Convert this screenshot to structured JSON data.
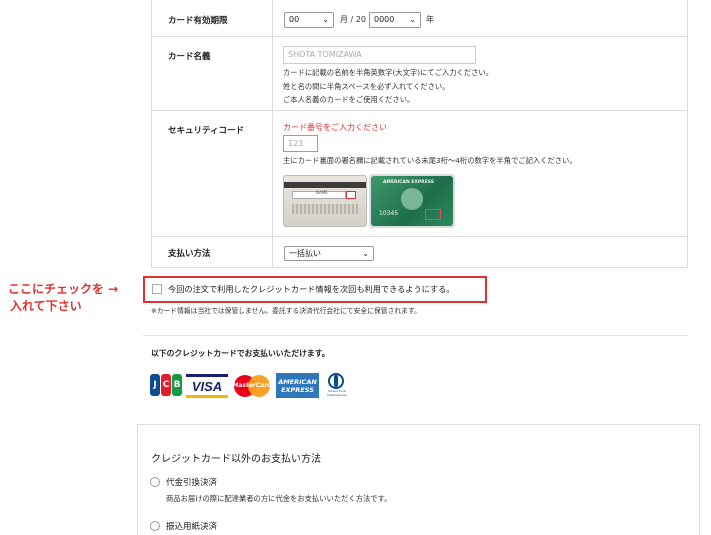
{
  "expiry": {
    "label": "カード有効期限",
    "month_value": "00",
    "month_suffix": "月 / 20",
    "year_value": "0000",
    "year_suffix": "年"
  },
  "cardname": {
    "label": "カード名義",
    "placeholder": "SHOTA TOMIZAWA",
    "notes": [
      "カードに記載の名前を半角英数字(大文字)にてご入力ください。",
      "姓と名の間に半角スペースを必ず入れてください。",
      "ご本人名義のカードをご使用ください。"
    ]
  },
  "security": {
    "label": "セキュリティコード",
    "error": "カード番号をご入力ください",
    "placeholder": "123",
    "note": "主にカード裏面の署名欄に記載されている末尾3桁〜4桁の数字を半角でご記入ください。",
    "back_card_text": "NAME",
    "amex_brand": "AMERICAN EXPRESS",
    "amex_number": "10345"
  },
  "payment_method": {
    "label": "支払い方法",
    "value": "一括払い"
  },
  "annotation": {
    "line1": "ここにチェックを →",
    "line2": "入れて下さい"
  },
  "save_card": {
    "label": "今回の注文で利用したクレジットカード情報を次回も利用できるようにする。",
    "note": "※カード情報は当社では保管しません。委託する決済代行会社にて安全に保管されます。"
  },
  "accepted_cards": {
    "heading": "以下のクレジットカードでお支払いいただけます。",
    "logos": {
      "jcb": "JCB",
      "visa": "VISA",
      "mastercard": "MasterCard",
      "amex_top": "AMERICAN",
      "amex_bottom": "EXPRESS",
      "diners_top": "Diners Club",
      "diners_bottom": "International"
    }
  },
  "other_methods": {
    "heading": "クレジットカード以外のお支払い方法",
    "cod_label": "代金引換決済",
    "cod_desc": "商品お届けの際に配達業者の方に代金をお支払いいただく方法です。",
    "transfer_label": "振込用紙決済"
  },
  "colors": {
    "accent_red": "#e03030",
    "border": "#dcdcdc"
  }
}
